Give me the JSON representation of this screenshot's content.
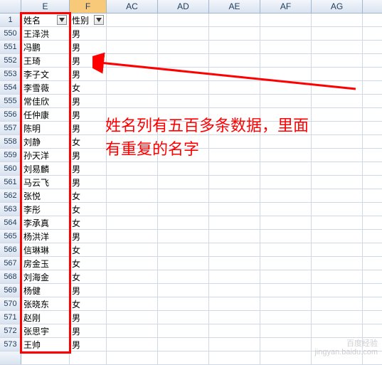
{
  "columns": {
    "E": "E",
    "F": "F",
    "AC": "AC",
    "AD": "AD",
    "AE": "AE",
    "AF": "AF",
    "AG": "AG"
  },
  "header_row": "1",
  "filters": {
    "name_label": "姓名",
    "sex_label": "性别"
  },
  "rows": [
    {
      "n": "550",
      "name": "王泽洪",
      "sex": "男"
    },
    {
      "n": "551",
      "name": "冯鹏",
      "sex": "男"
    },
    {
      "n": "552",
      "name": "王琦",
      "sex": "男"
    },
    {
      "n": "553",
      "name": "李子文",
      "sex": "男"
    },
    {
      "n": "554",
      "name": "李雪薇",
      "sex": "女"
    },
    {
      "n": "555",
      "name": "常佳欣",
      "sex": "男"
    },
    {
      "n": "556",
      "name": "任仲康",
      "sex": "男"
    },
    {
      "n": "557",
      "name": "陈明",
      "sex": "男"
    },
    {
      "n": "558",
      "name": "刘静",
      "sex": "女"
    },
    {
      "n": "559",
      "name": "孙天洋",
      "sex": "男"
    },
    {
      "n": "560",
      "name": "刘易麟",
      "sex": "男"
    },
    {
      "n": "561",
      "name": "马云飞",
      "sex": "男"
    },
    {
      "n": "562",
      "name": "张悦",
      "sex": "女"
    },
    {
      "n": "563",
      "name": "李彤",
      "sex": "女"
    },
    {
      "n": "564",
      "name": "李承真",
      "sex": "女"
    },
    {
      "n": "565",
      "name": "杨洪洋",
      "sex": "男"
    },
    {
      "n": "566",
      "name": "信琳琳",
      "sex": "女"
    },
    {
      "n": "567",
      "name": "房金玉",
      "sex": "女"
    },
    {
      "n": "568",
      "name": "刘海金",
      "sex": "女"
    },
    {
      "n": "569",
      "name": "杨健",
      "sex": "男"
    },
    {
      "n": "570",
      "name": "张晓东",
      "sex": "女"
    },
    {
      "n": "571",
      "name": "赵刚",
      "sex": "男"
    },
    {
      "n": "572",
      "name": "张思宇",
      "sex": "男"
    },
    {
      "n": "573",
      "name": "王帅",
      "sex": "男"
    }
  ],
  "annotation": {
    "line1": "姓名列有五百多条数据，里面",
    "line2": "有重复的名字"
  },
  "watermark": {
    "line1": "百度经验",
    "line2": "jingyan.baidu.com"
  }
}
